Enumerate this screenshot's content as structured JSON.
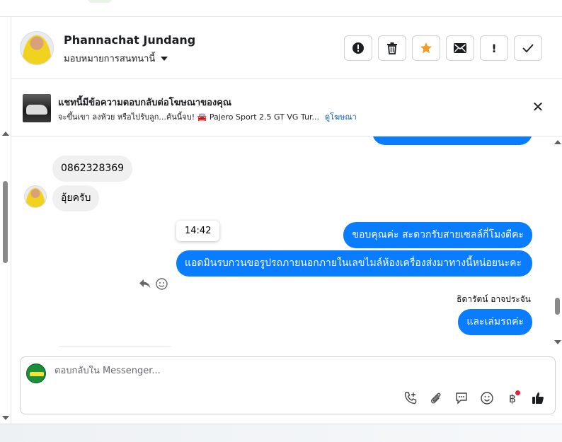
{
  "header": {
    "contact_name": "Phannachat Jundang",
    "assign_label": "มอบหมายการสนทนานี้",
    "actions": [
      {
        "icon": "alert-circle-icon",
        "glyph": "!"
      },
      {
        "icon": "trash-icon",
        "glyph": "🗑"
      },
      {
        "icon": "star-icon",
        "glyph": "★"
      },
      {
        "icon": "envelope-icon",
        "glyph": "✉"
      },
      {
        "icon": "exclamation-icon",
        "glyph": "!"
      },
      {
        "icon": "checkmark-icon",
        "glyph": "✓"
      }
    ]
  },
  "ad_banner": {
    "title": "แชทนี้มีข้อความตอบกลับต่อโฆษณาของคุณ",
    "subtitle": "จะขึ้นเขา ลงห้วย หรือไปรับลูก...คันนี้จบ! 🚘 Pajero Sport 2.5 GT VG Tur...",
    "link": "ดูโฆษณา",
    "close": "✕"
  },
  "messages": {
    "incoming_phone": "0862328369",
    "incoming_ok": "อุ้ยครับ",
    "timestamp": "14:42",
    "outgoing_thanks": "ขอบคุณค่ะ สะดวกรับสายเซลล์กี่โมงดีคะ",
    "outgoing_admin": "แอดมินรบกวนขอรูปรถภายนอกภายในเลขไมล์ห้องเครื่องส่งมาทางนี้หน่อยนะคะ",
    "sender_name": "ธิดารัตน์ อาจประจัน",
    "outgoing_book": "และเล่มรถค่ะ"
  },
  "composer": {
    "placeholder": "ตอบกลับใน Messenger...",
    "tools": [
      "phone-add-icon",
      "paperclip-icon",
      "chat-icon",
      "emoji-icon",
      "baht-icon",
      "thumbs-up-icon"
    ],
    "baht_glyph": "฿",
    "like_glyph": "👍"
  },
  "colors": {
    "outgoing_bubble": "#0a7cff",
    "incoming_bubble": "#f0f0f0",
    "link": "#0a5fc4",
    "notification_dot": "#e41e3f"
  }
}
